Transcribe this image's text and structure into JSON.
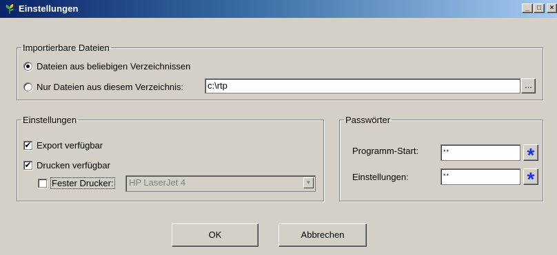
{
  "window": {
    "title": "Einstellungen",
    "controls": {
      "minimize": "_",
      "maximize": "□",
      "close": "×"
    }
  },
  "import_group": {
    "legend": "Importierbare Dateien",
    "option_any": {
      "label": "Dateien aus beliebigen Verzeichnissen",
      "checked": true
    },
    "option_dir": {
      "label": "Nur Dateien aus diesem Verzeichnis:",
      "checked": false
    },
    "directory_value": "c:\\rtp",
    "browse_label": "..."
  },
  "settings_group": {
    "legend": "Einstellungen",
    "export_label": "Export verfügbar",
    "export_checked": true,
    "print_label": "Drucken verfügbar",
    "print_checked": true,
    "fixed_printer_label": "Fester Drucker:",
    "fixed_printer_checked": false,
    "printer_value": "HP LaserJet 4"
  },
  "password_group": {
    "legend": "Passwörter",
    "program_start_label": "Programm-Start:",
    "program_start_value": "**",
    "settings_label": "Einstellungen:",
    "settings_value": "**"
  },
  "buttons": {
    "ok": "OK",
    "cancel": "Abbrechen"
  },
  "icons": {
    "app": "plant-icon",
    "star": "asterisk-icon"
  },
  "colors": {
    "title_start": "#0a246a",
    "title_end": "#a6caf0",
    "star": "#1432e6"
  }
}
